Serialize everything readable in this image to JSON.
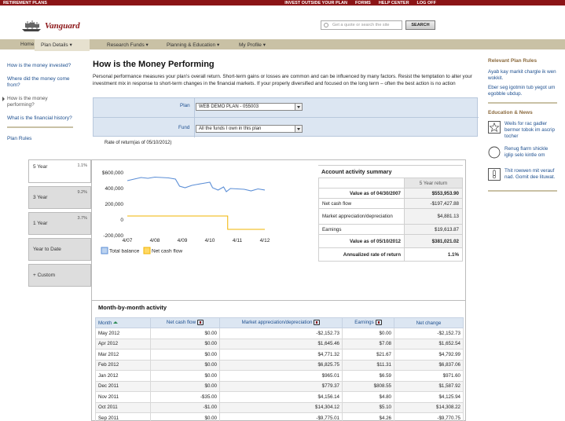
{
  "topbar": {
    "left_label": "RETIREMENT PLANS",
    "links": [
      "INVEST OUTSIDE YOUR PLAN",
      "FORMS",
      "HELP CENTER",
      "LOG OFF"
    ]
  },
  "brand": {
    "name": "Vanguard"
  },
  "search": {
    "placeholder": "Get a quote or search the site",
    "button_label": "SEARCH"
  },
  "nav": {
    "home": "Home",
    "plan_details": "Plan Details",
    "research_funds": "Research Funds",
    "planning": "Planning & Education",
    "profile": "My Profile"
  },
  "leftnav": {
    "items": [
      "How is the money invested?",
      "Where did the money come from?",
      "How is the money performing?",
      "What is the financial history?"
    ],
    "plan_rules": "Plan Rules"
  },
  "page": {
    "title": "How is the Money Performing",
    "intro": "Personal performance measures your plan's overall return. Short-term gains or losses are common and can be influenced by many factors. Resist the temptation to alter your investment mix in response to short-term changes in the financial markets. If your properly diversified and focused on the long term – often the best action is no action"
  },
  "form": {
    "plan_label": "Plan",
    "plan_value": "WEB DEMO PLAN - 055003",
    "fund_label": "Fund",
    "fund_value": "All the funds I own in this plan"
  },
  "rate_of_return": "Rate of return(as of 05/10/2012)",
  "periods": [
    {
      "label": "5 Year",
      "value": "1.1%"
    },
    {
      "label": "3 Year",
      "value": "9.2%"
    },
    {
      "label": "1 Year",
      "value": "3.7%"
    },
    {
      "label": "Year to Date",
      "value": ""
    },
    {
      "label": "+ Custom",
      "value": ""
    }
  ],
  "chart_data": {
    "type": "line",
    "x_ticks": [
      "4/07",
      "4/08",
      "4/09",
      "4/10",
      "4/11",
      "4/12"
    ],
    "y_ticks": [
      "$600,000",
      "400,000",
      "200,000",
      "0",
      "-200,000"
    ],
    "ylim": [
      -200000,
      600000
    ],
    "series": [
      {
        "name": "Total balance",
        "color": "#5b8ed6",
        "x": [
          0,
          0.05,
          0.1,
          0.15,
          0.2,
          0.25,
          0.3,
          0.35,
          0.38,
          0.42,
          0.47,
          0.5,
          0.55,
          0.6,
          0.62,
          0.66,
          0.7,
          0.72,
          0.75,
          0.8,
          0.85,
          0.9,
          0.95,
          1.0
        ],
        "y": [
          500000,
          520000,
          540000,
          530000,
          545000,
          540000,
          535000,
          520000,
          430000,
          410000,
          440000,
          450000,
          465000,
          480000,
          410000,
          380000,
          420000,
          360000,
          400000,
          395000,
          390000,
          370000,
          395000,
          381000
        ]
      },
      {
        "name": "Net cash flow",
        "color": "#f0b400",
        "x": [
          0,
          0.73,
          0.73,
          1.0
        ],
        "y": [
          50000,
          50000,
          -120000,
          -120000
        ]
      }
    ],
    "legend": "bottom-left"
  },
  "account_summary": {
    "title": "Account activity summary",
    "period_header": "5 Year return",
    "rows": [
      {
        "label": "Value as of 04/30/2007",
        "value": "$553,953.90",
        "bold": true
      },
      {
        "label": "Net cash flow",
        "value": "-$197,427.88",
        "bold": false
      },
      {
        "label": "Market appreciation/depreciation",
        "value": "$4,881.13",
        "bold": false
      },
      {
        "label": "Earnings",
        "value": "$19,613.87",
        "bold": false
      },
      {
        "label": "Value as of 05/10/2012",
        "value": "$381,021.02",
        "bold": true
      },
      {
        "label": "Annualized rate of return",
        "value": "1.1%",
        "bold": true
      }
    ]
  },
  "monthly": {
    "title": "Month-by-month activity",
    "columns": [
      "Month",
      "Net cash flow",
      "Market appreciation/depreciation",
      "Earnings",
      "Net change"
    ],
    "rows": [
      [
        "May 2012",
        "$0.00",
        "-$2,152.73",
        "$0.00",
        "-$2,152.73"
      ],
      [
        "Apr 2012",
        "$0.00",
        "$1,645.46",
        "$7.08",
        "$1,652.54"
      ],
      [
        "Mar 2012",
        "$0.00",
        "$4,771.32",
        "$21.67",
        "$4,792.99"
      ],
      [
        "Feb 2012",
        "$0.00",
        "$6,825.75",
        "$11.31",
        "$6,837.06"
      ],
      [
        "Jan 2012",
        "$0.00",
        "$965.01",
        "$6.59",
        "$971.60"
      ],
      [
        "Dec 2011",
        "$0.00",
        "$779.37",
        "$808.55",
        "$1,587.92"
      ],
      [
        "Nov 2011",
        "-$35.00",
        "$4,156.14",
        "$4.80",
        "$4,125.94"
      ],
      [
        "Oct 2011",
        "-$1.00",
        "$14,304.12",
        "$5.10",
        "$14,308.22"
      ],
      [
        "Sep 2011",
        "$0.00",
        "-$9,775.01",
        "$4.26",
        "-$9,770.75"
      ]
    ]
  },
  "rightcol": {
    "rules_title": "Relevant Plan Rules",
    "rules": [
      "Ayab kay markit chargle ik wen wokkit.",
      "Eber seg igotmin tub yegot um egobble ubdup."
    ],
    "news_title": "Education & News",
    "news": [
      {
        "text": "Weils for rac gadler bermer tobok im ascrip tocher",
        "icon": "star-icon"
      },
      {
        "text": "Renug flarm shickle iglip selo kintle om",
        "icon": "clock-icon"
      },
      {
        "text": "Thit rowwen mit verauf nad. Gomit dee lituwat.",
        "icon": "thermometer-icon"
      }
    ]
  }
}
